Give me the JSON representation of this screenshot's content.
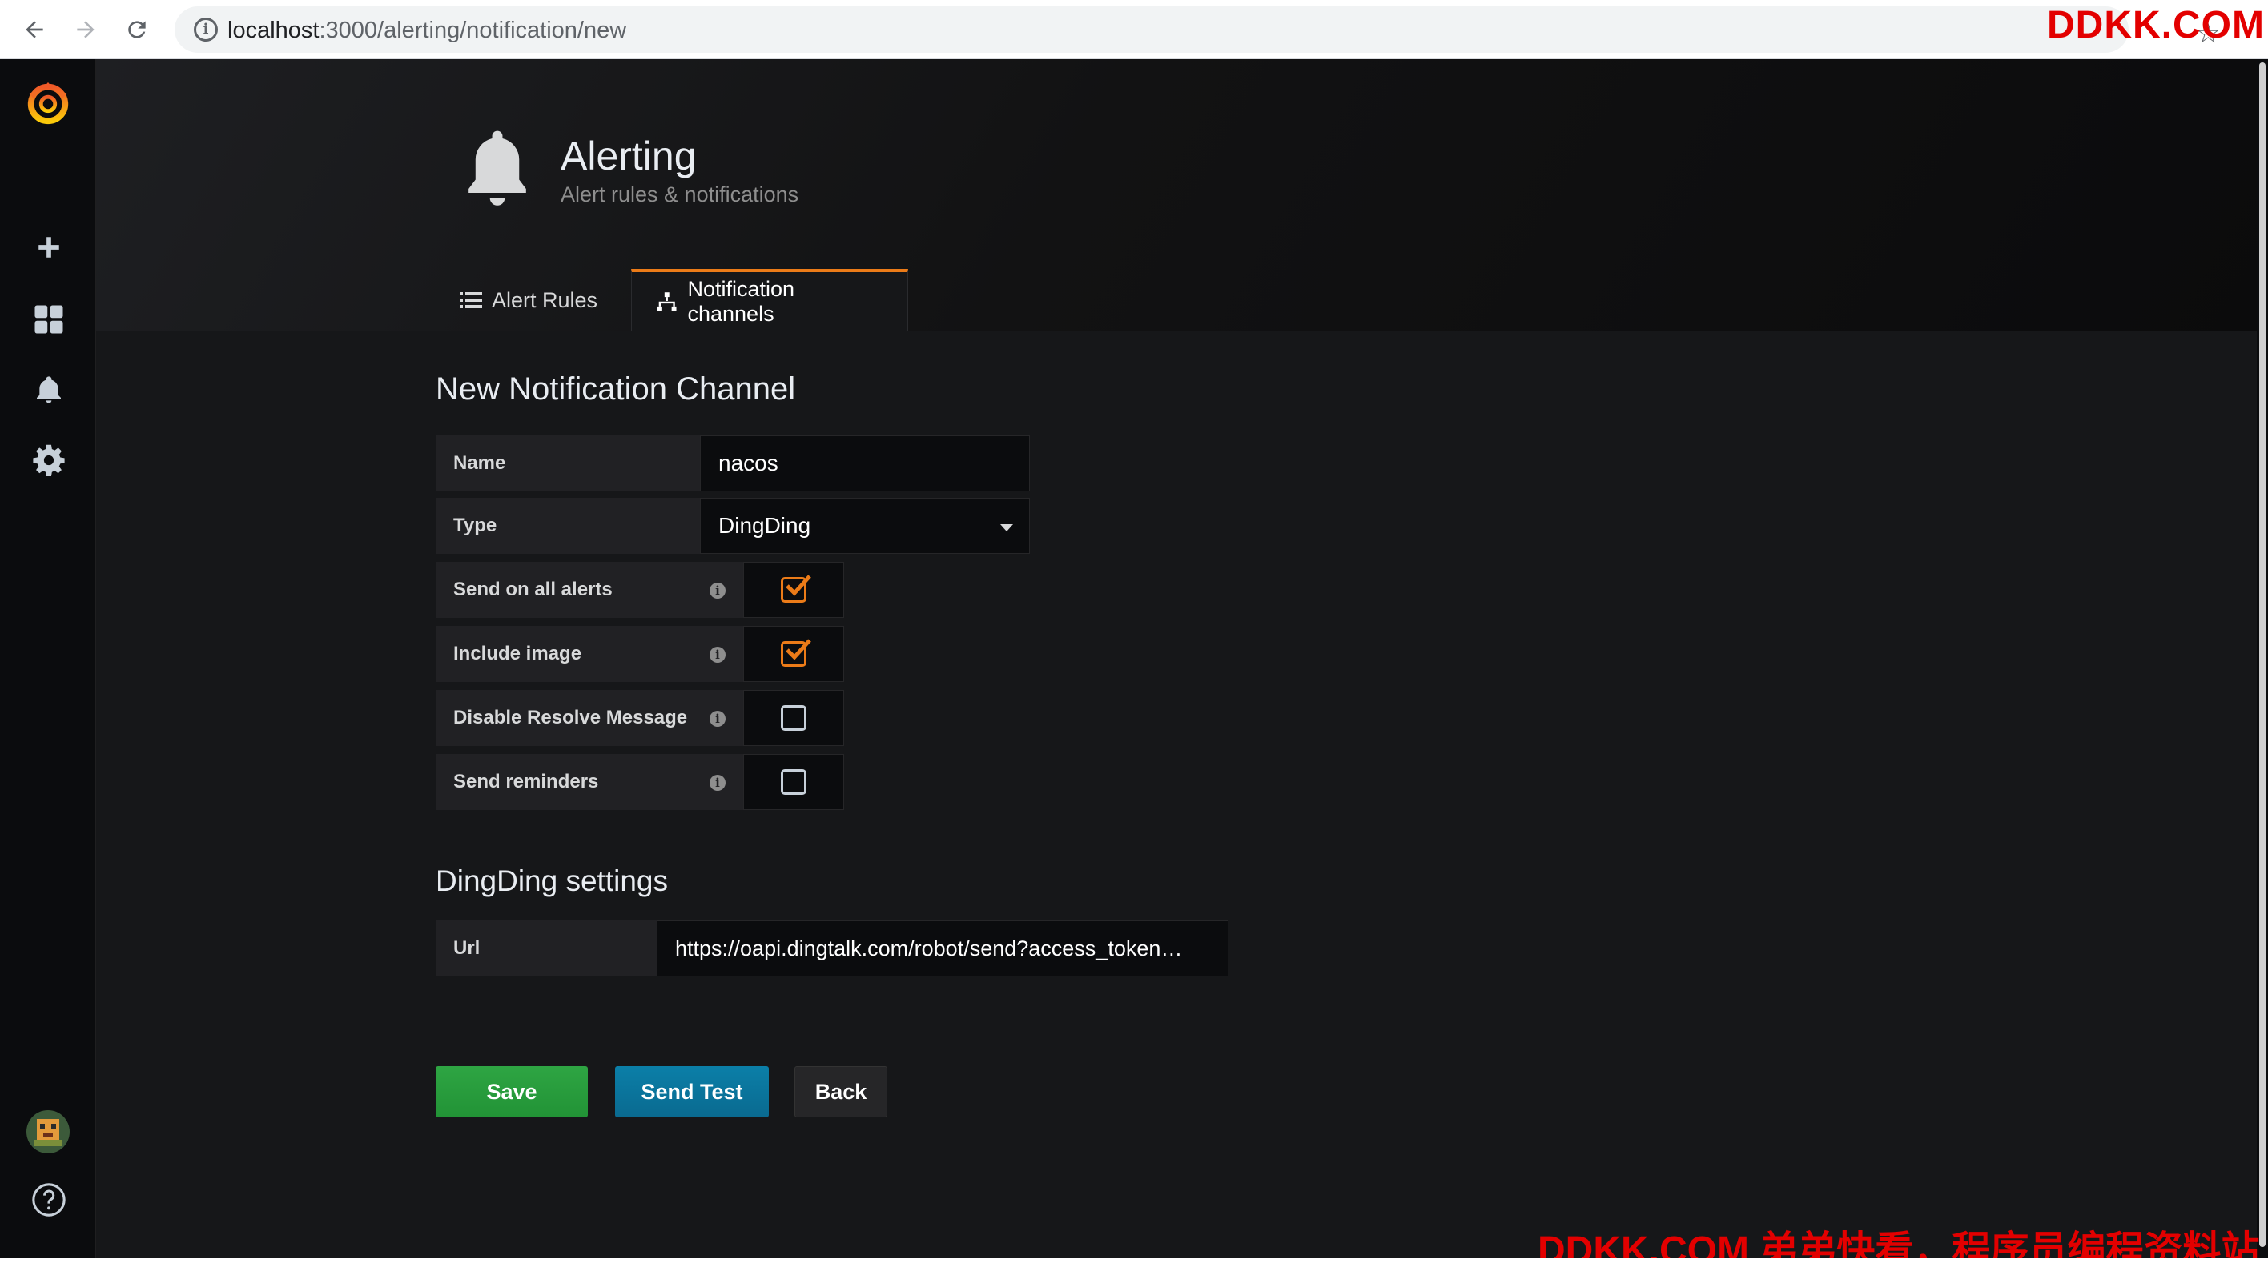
{
  "browser": {
    "url_host": "localhost",
    "url_path": ":3000/alerting/notification/new",
    "watermark_top": "DDKK.COM"
  },
  "header": {
    "title": "Alerting",
    "subtitle": "Alert rules & notifications"
  },
  "tabs": [
    {
      "label": "Alert Rules",
      "active": false
    },
    {
      "label": "Notification channels",
      "active": true
    }
  ],
  "form": {
    "title": "New Notification Channel",
    "name_label": "Name",
    "name_value": "nacos",
    "type_label": "Type",
    "type_value": "DingDing",
    "options": [
      {
        "label": "Send on all alerts",
        "checked": true
      },
      {
        "label": "Include image",
        "checked": true
      },
      {
        "label": "Disable Resolve Message",
        "checked": false
      },
      {
        "label": "Send reminders",
        "checked": false
      }
    ]
  },
  "settings": {
    "title": "DingDing settings",
    "url_label": "Url",
    "url_value": "https://oapi.dingtalk.com/robot/send?access_token…"
  },
  "buttons": {
    "save": "Save",
    "send_test": "Send Test",
    "back": "Back"
  },
  "watermark_bottom": "DDKK.COM 弟弟快看，程序员编程资料站",
  "colors": {
    "accent_orange": "#eb7b18",
    "save_green": "#299c3e",
    "test_blue": "#0b77a0",
    "background": "#161719"
  }
}
